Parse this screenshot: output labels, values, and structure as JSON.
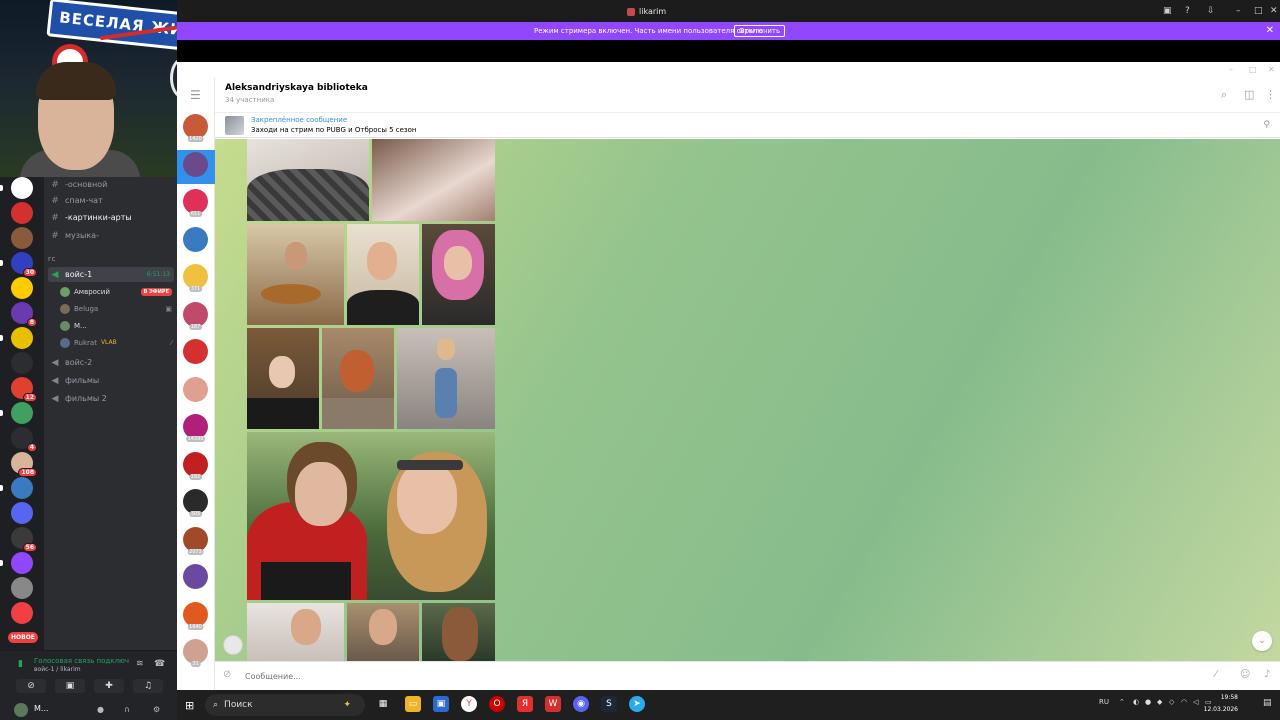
{
  "window": {
    "title": "likarim"
  },
  "streamer_mode": {
    "message": "Режим стримера включен. Часть имени пользователя скрыта.",
    "disable_label": "Отключить"
  },
  "discord": {
    "channels": [
      {
        "name": "-основной",
        "type": "text"
      },
      {
        "name": "спам-чат",
        "type": "text"
      },
      {
        "name": "-картинки-арты",
        "type": "text"
      },
      {
        "name": "музыка-",
        "type": "text"
      }
    ],
    "category": "гс",
    "voice_active": {
      "name": "войс-1",
      "time": "6:51:13"
    },
    "voice_users": [
      {
        "name": "Амвросий",
        "live": "В ЭФИРЕ",
        "color": "#6aa06a"
      },
      {
        "name": "Beluga",
        "color": "#7a6a5a"
      },
      {
        "name": "М...",
        "color": "#6a8a6a"
      },
      {
        "name": "Rukrat",
        "tag": "VLAB",
        "color": "#5a6a8a"
      }
    ],
    "voice_channels": [
      {
        "name": "войс-2"
      },
      {
        "name": "фильмы"
      },
      {
        "name": "фильмы 2"
      }
    ],
    "voice_status": "Голосовая связь подключ",
    "voice_sub": "войс-1 / likarim",
    "new_badge": "НОВОЕ",
    "username": "М...",
    "server_badges": [
      "30",
      "8",
      "",
      "12",
      "4",
      "108",
      "56"
    ],
    "server_colors": [
      "#ffffff",
      "#d43030",
      "#8a5a3a",
      "#3040c0",
      "#ffcc00",
      "#6a3ab0",
      "#e8c000",
      "#2b2d31",
      "#e04030",
      "#40a060",
      "#2b2d31",
      "#d9b49b",
      "#3a7ac0",
      "#5865f2",
      "#3a3a3a",
      "#9146ff",
      "#888888",
      "#f23f42"
    ]
  },
  "telegram": {
    "chat_name": "Aleksandriyskaya biblioteka",
    "members": "34 участника",
    "pinned_title": "Закреплённое сообщение",
    "pinned_text": "Заходи на стрим по PUBG и Отбросы 5 сезон",
    "composer_placeholder": "Сообщение...",
    "chat_counts": [
      "1420",
      "",
      "611",
      "",
      "371",
      "187",
      "",
      "",
      "14399",
      "192",
      "305",
      "2073",
      "",
      "1640",
      "31"
    ],
    "chat_colors": [
      "#c85a3a",
      "#6a4a8a",
      "#e0305a",
      "#3a7ac0",
      "#f0c040",
      "#c04a6a",
      "#d43030",
      "#e0a090",
      "#b0207a",
      "#c02020",
      "#2a2a2a",
      "#a04a2a",
      "#6a4aa0",
      "#e05a20",
      "#d0a090"
    ]
  },
  "taskbar": {
    "search_label": "Поиск",
    "lang": "RU",
    "time": "19:58",
    "date": "12.03.2026"
  }
}
